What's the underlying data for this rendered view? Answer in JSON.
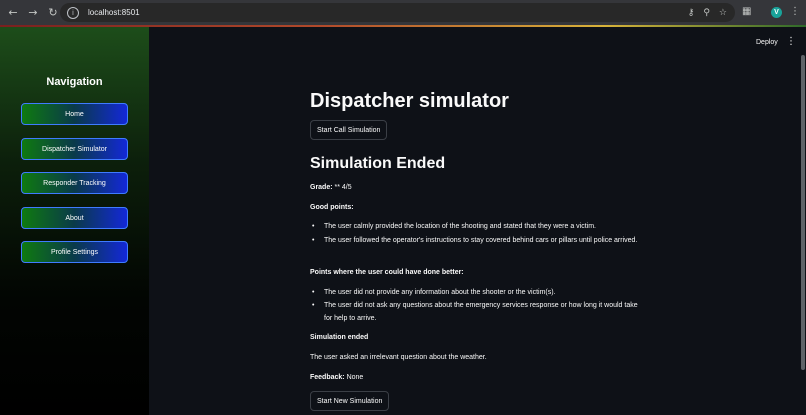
{
  "browser": {
    "url": "localhost:8501",
    "profile_initial": "V"
  },
  "header": {
    "deploy_label": "Deploy",
    "menu_icon": "kebab-menu-icon"
  },
  "sidebar": {
    "title": "Navigation",
    "items": [
      {
        "label": "Home"
      },
      {
        "label": "Dispatcher Simulator"
      },
      {
        "label": "Responder Tracking"
      },
      {
        "label": "About"
      },
      {
        "label": "Profile Settings"
      }
    ]
  },
  "main": {
    "title": "Dispatcher simulator",
    "start_call_button": "Start Call Simulation",
    "section_title": "Simulation Ended",
    "grade_label": "Grade:",
    "grade_value": " ** 4/5",
    "good_points_heading": "Good points:",
    "good_points": [
      "The user calmly provided the location of the shooting and stated that they were a victim.",
      "The user followed the operator's instructions to stay covered behind cars or pillars until police arrived."
    ],
    "improve_heading": "Points where the user could have done better:",
    "improve_points": [
      "The user did not provide any information about the shooter or the victim(s).",
      "The user did not ask any questions about the emergency services response or how long it would take for help to arrive."
    ],
    "ended_heading": "Simulation ended",
    "ended_text": "The user asked an irrelevant question about the weather.",
    "feedback_label": "Feedback:",
    "feedback_value": " None",
    "start_new_button": "Start New Simulation"
  },
  "colors": {
    "background": "#0e1117",
    "nav_button_green": "#0f7a10",
    "nav_button_blue": "#1328d8",
    "text": "#fafafa"
  }
}
